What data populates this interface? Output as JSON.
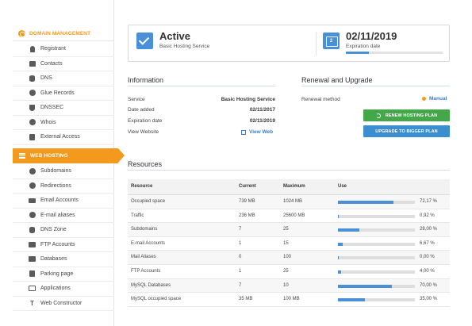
{
  "sidebar": {
    "domain_header": "DOMAIN MANAGEMENT",
    "domain_items": [
      {
        "label": "Registrant",
        "icon": "person-icon"
      },
      {
        "label": "Contacts",
        "icon": "contacts-icon"
      },
      {
        "label": "DNS",
        "icon": "dns-icon"
      },
      {
        "label": "Glue Records",
        "icon": "gear-icon"
      },
      {
        "label": "DNSSEC",
        "icon": "shield-icon"
      },
      {
        "label": "Whois",
        "icon": "globe-icon"
      },
      {
        "label": "External Access",
        "icon": "external-access-icon"
      }
    ],
    "web_header": "WEB HOSTING",
    "web_items": [
      {
        "label": "Subdomains",
        "icon": "subdomains-icon"
      },
      {
        "label": "Redirections",
        "icon": "redirect-icon"
      },
      {
        "label": "Email Accounts",
        "icon": "envelope-icon"
      },
      {
        "label": "E-mail aliases",
        "icon": "at-icon"
      },
      {
        "label": "DNS Zone",
        "icon": "dns-zone-icon"
      },
      {
        "label": "FTP Accounts",
        "icon": "folder-icon"
      },
      {
        "label": "Databases",
        "icon": "database-icon"
      },
      {
        "label": "Parking page",
        "icon": "page-icon"
      },
      {
        "label": "Applications",
        "icon": "window-icon"
      },
      {
        "label": "Web Constructor",
        "icon": "text-tool-icon"
      }
    ]
  },
  "status": {
    "state": "Active",
    "plan": "Basic Hosting Service",
    "expiration": "02/11/2019",
    "expiration_label": "Expiration date",
    "expiration_progress": 0.24,
    "calendar_day": "2"
  },
  "information": {
    "title": "Information",
    "rows": [
      {
        "label": "Service",
        "value": "Basic Hosting Service"
      },
      {
        "label": "Date added",
        "value": "02/11/2017"
      },
      {
        "label": "Expiration date",
        "value": "02/11/2019"
      }
    ],
    "website_label": "View Website",
    "website_link": "View Web"
  },
  "renewal": {
    "title": "Renewal and Upgrade",
    "method_label": "Renewal method",
    "method_value": "Manual",
    "renew_button": "RENEW HOSTING PLAN",
    "upgrade_button": "UPGRADE TO BIGGER PLAN"
  },
  "resources": {
    "title": "Resources",
    "columns": [
      "Resource",
      "Current",
      "Maximum",
      "Use"
    ],
    "rows": [
      {
        "name": "Occupied space",
        "current": "739 MB",
        "max": "1024 MB",
        "use": 0.7217,
        "pct": "72,17 %"
      },
      {
        "name": "Traffic",
        "current": "236 MB",
        "max": "25600 MB",
        "use": 0.0092,
        "pct": "0,92 %"
      },
      {
        "name": "Subdomains",
        "current": "7",
        "max": "25",
        "use": 0.28,
        "pct": "28,00 %"
      },
      {
        "name": "E-mail Accounts",
        "current": "1",
        "max": "15",
        "use": 0.0667,
        "pct": "6,67 %"
      },
      {
        "name": "Mail Aliases",
        "current": "0",
        "max": "100",
        "use": 0.0,
        "pct": "0,00 %"
      },
      {
        "name": "FTP Accounts",
        "current": "1",
        "max": "25",
        "use": 0.04,
        "pct": "4,00 %"
      },
      {
        "name": "MySQL Databases",
        "current": "7",
        "max": "10",
        "use": 0.7,
        "pct": "70,00 %"
      },
      {
        "name": "MySQL occupied space",
        "current": "35 MB",
        "max": "100 MB",
        "use": 0.35,
        "pct": "35,00 %"
      }
    ]
  },
  "colors": {
    "accent": "#f39a1e",
    "primary": "#4a90d9",
    "success": "#44a74a"
  }
}
